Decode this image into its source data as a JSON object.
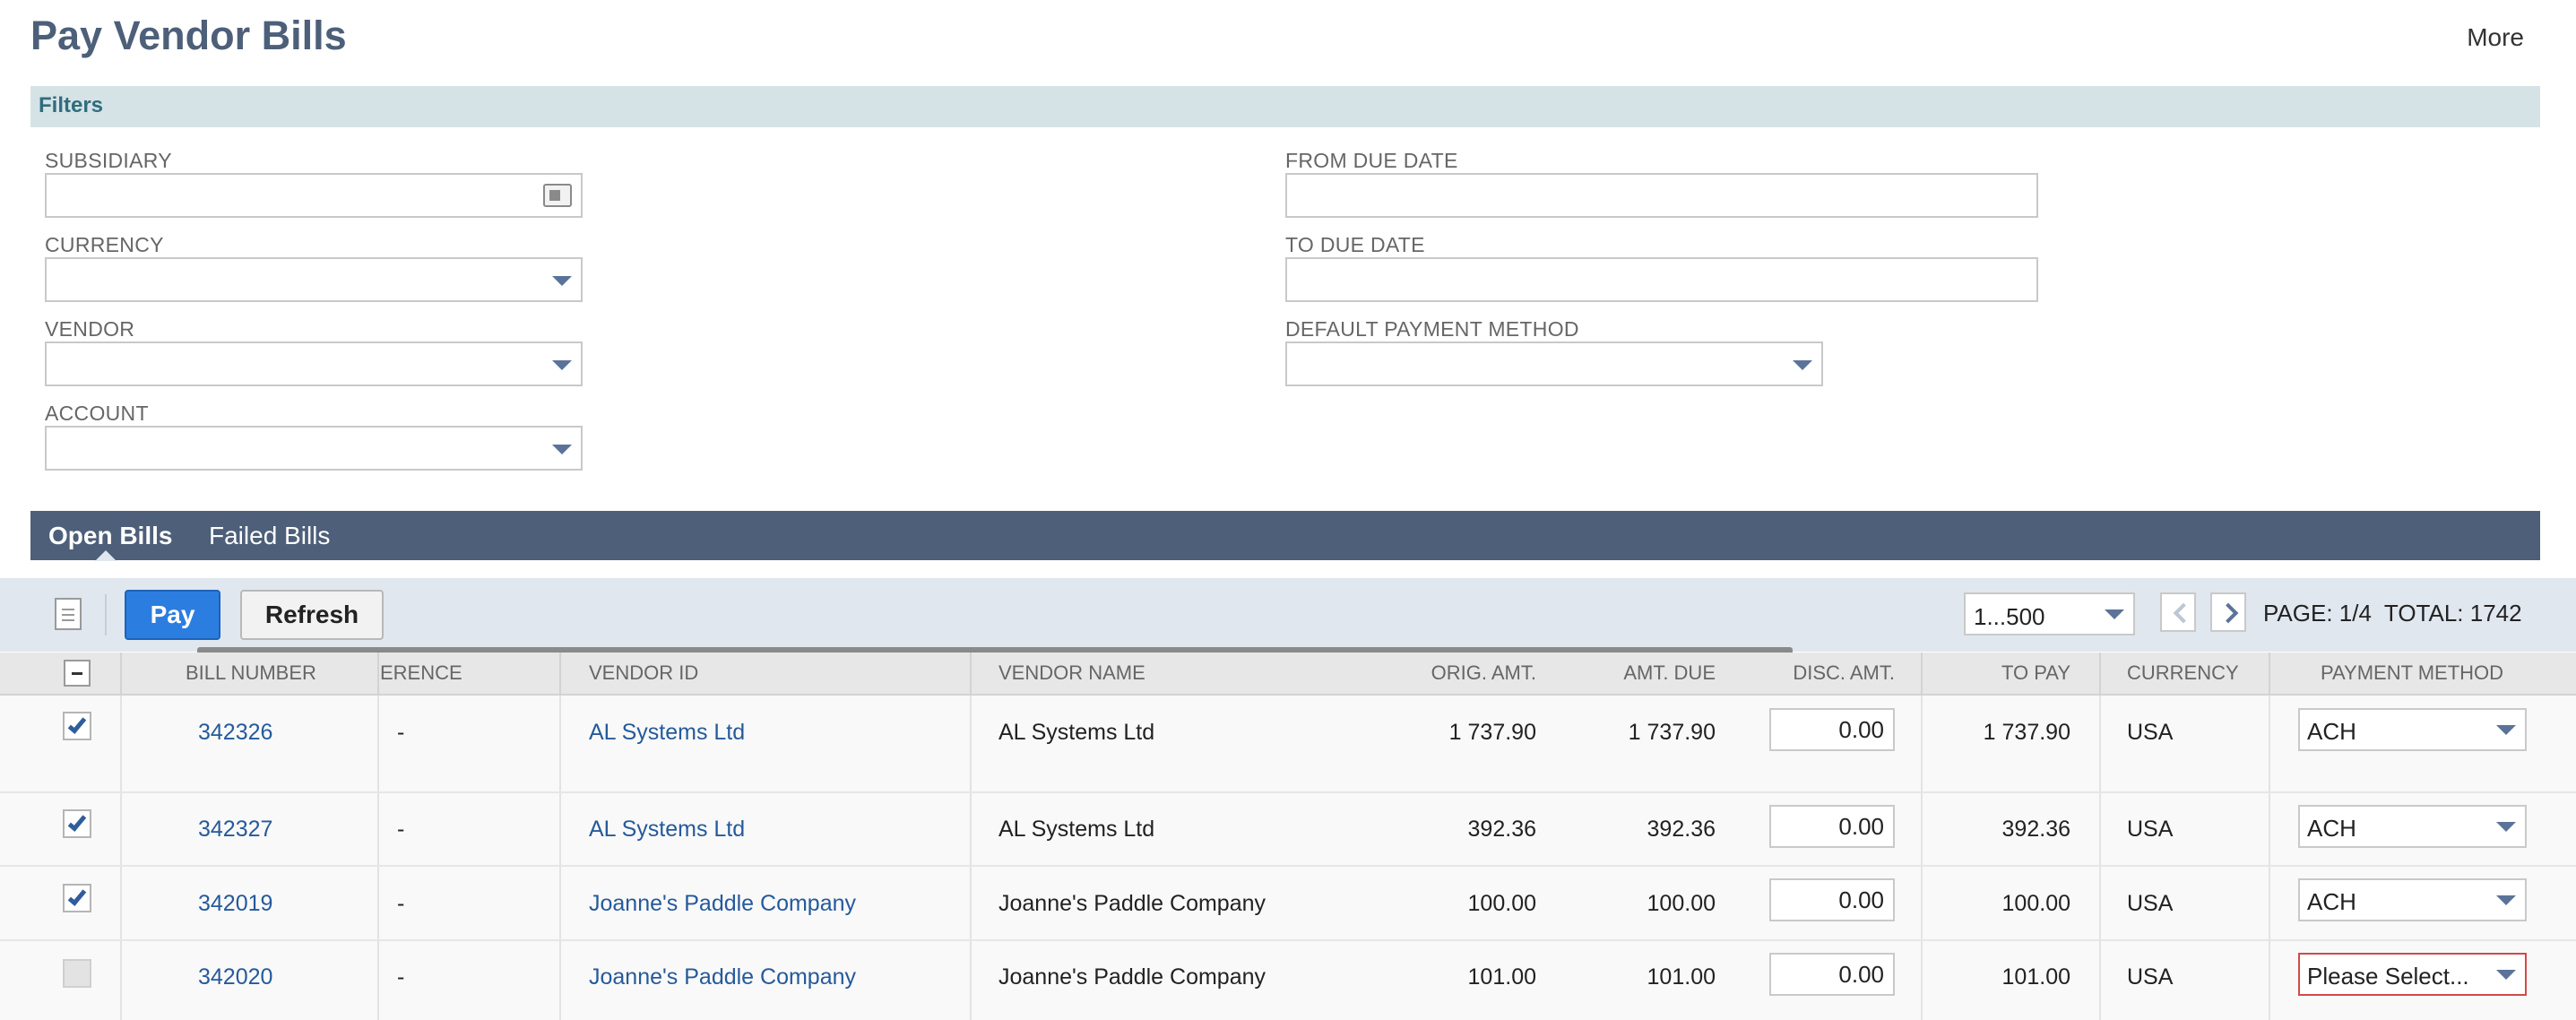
{
  "page": {
    "title": "Pay Vendor Bills",
    "more_label": "More"
  },
  "filters": {
    "section_label": "Filters",
    "subsidiary": {
      "label": "SUBSIDIARY",
      "value": ""
    },
    "currency": {
      "label": "CURRENCY",
      "value": ""
    },
    "vendor": {
      "label": "VENDOR",
      "value": ""
    },
    "account": {
      "label": "ACCOUNT",
      "value": ""
    },
    "from_due_date": {
      "label": "FROM DUE DATE",
      "value": ""
    },
    "to_due_date": {
      "label": "TO DUE DATE",
      "value": ""
    },
    "default_payment_method": {
      "label": "DEFAULT PAYMENT METHOD",
      "value": ""
    }
  },
  "tabs": [
    {
      "label": "Open Bills",
      "active": true
    },
    {
      "label": "Failed Bills",
      "active": false
    }
  ],
  "toolbar": {
    "pay_label": "Pay",
    "refresh_label": "Refresh",
    "range_value": "1...500",
    "page_info": "PAGE: 1/4",
    "total_info": "TOTAL: 1742"
  },
  "table": {
    "columns": {
      "bill_number": "BILL NUMBER",
      "reference": "ERENCE",
      "vendor_id": "VENDOR ID",
      "vendor_name": "VENDOR NAME",
      "orig_amt": "ORIG. AMT.",
      "amt_due": "AMT. DUE",
      "disc_amt": "DISC. AMT.",
      "to_pay": "TO PAY",
      "currency": "CURRENCY",
      "payment_method": "PAYMENT METHOD"
    },
    "rows": [
      {
        "checked": true,
        "bill_number": "342326",
        "reference": "-",
        "vendor_id": "AL Systems Ltd",
        "vendor_name": "AL Systems Ltd",
        "orig_amt": "1 737.90",
        "amt_due": "1 737.90",
        "disc_amt": "0.00",
        "to_pay": "1 737.90",
        "currency": "USA",
        "payment_method": "ACH"
      },
      {
        "checked": true,
        "bill_number": "342327",
        "reference": "-",
        "vendor_id": "AL Systems Ltd",
        "vendor_name": "AL Systems Ltd",
        "orig_amt": "392.36",
        "amt_due": "392.36",
        "disc_amt": "0.00",
        "to_pay": "392.36",
        "currency": "USA",
        "payment_method": "ACH"
      },
      {
        "checked": true,
        "bill_number": "342019",
        "reference": "-",
        "vendor_id": "Joanne's Paddle Company",
        "vendor_name": "Joanne's Paddle Company",
        "orig_amt": "100.00",
        "amt_due": "100.00",
        "disc_amt": "0.00",
        "to_pay": "100.00",
        "currency": "USA",
        "payment_method": "ACH"
      },
      {
        "checked": false,
        "bill_number": "342020",
        "reference": "-",
        "vendor_id": "Joanne's Paddle Company",
        "vendor_name": "Joanne's Paddle Company",
        "orig_amt": "101.00",
        "amt_due": "101.00",
        "disc_amt": "0.00",
        "to_pay": "101.00",
        "currency": "USA",
        "payment_method": "Please Select..."
      }
    ]
  }
}
